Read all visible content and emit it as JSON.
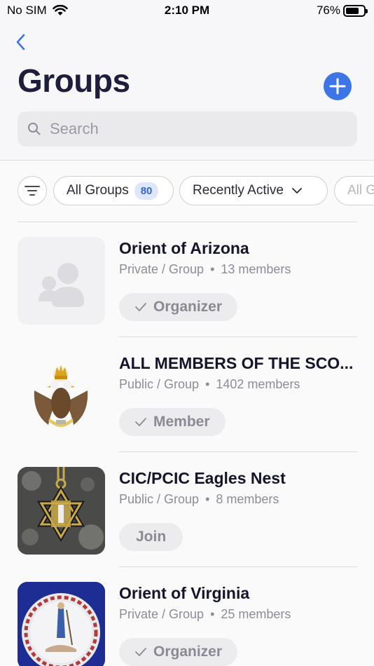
{
  "status_bar": {
    "carrier": "No SIM",
    "time": "2:10 PM",
    "battery": "76%",
    "battery_level": 0.76
  },
  "header": {
    "title": "Groups",
    "back_icon": "chevron-left-icon",
    "add_icon": "plus-icon"
  },
  "search": {
    "placeholder": "Search",
    "value": ""
  },
  "filters": {
    "all_groups_label": "All Groups",
    "all_groups_count": "80",
    "sort_label": "Recently Active",
    "next_chip_label": "All G"
  },
  "groups": [
    {
      "name": "Orient of Arizona",
      "privacy": "Private / Group",
      "members": "13 members",
      "role": "Organizer",
      "role_icon": "check-icon",
      "thumb": "group-placeholder-icon"
    },
    {
      "name": "ALL MEMBERS OF THE SCO...",
      "privacy": "Public / Group",
      "members": "1402 members",
      "role": "Member",
      "role_icon": "check-icon",
      "thumb": "double-headed-eagle-emblem"
    },
    {
      "name": "CIC/PCIC Eagles Nest",
      "privacy": "Public / Group",
      "members": "8 members",
      "role": "Join",
      "role_icon": "",
      "thumb": "medal-jewel-photo"
    },
    {
      "name": "Orient of Virginia",
      "privacy": "Private / Group",
      "members": "25 members",
      "role": "Organizer",
      "role_icon": "check-icon",
      "thumb": "virginia-state-seal"
    }
  ],
  "colors": {
    "accent": "#3d75e8",
    "title": "#1e1e3c",
    "muted": "#8d8d97"
  }
}
